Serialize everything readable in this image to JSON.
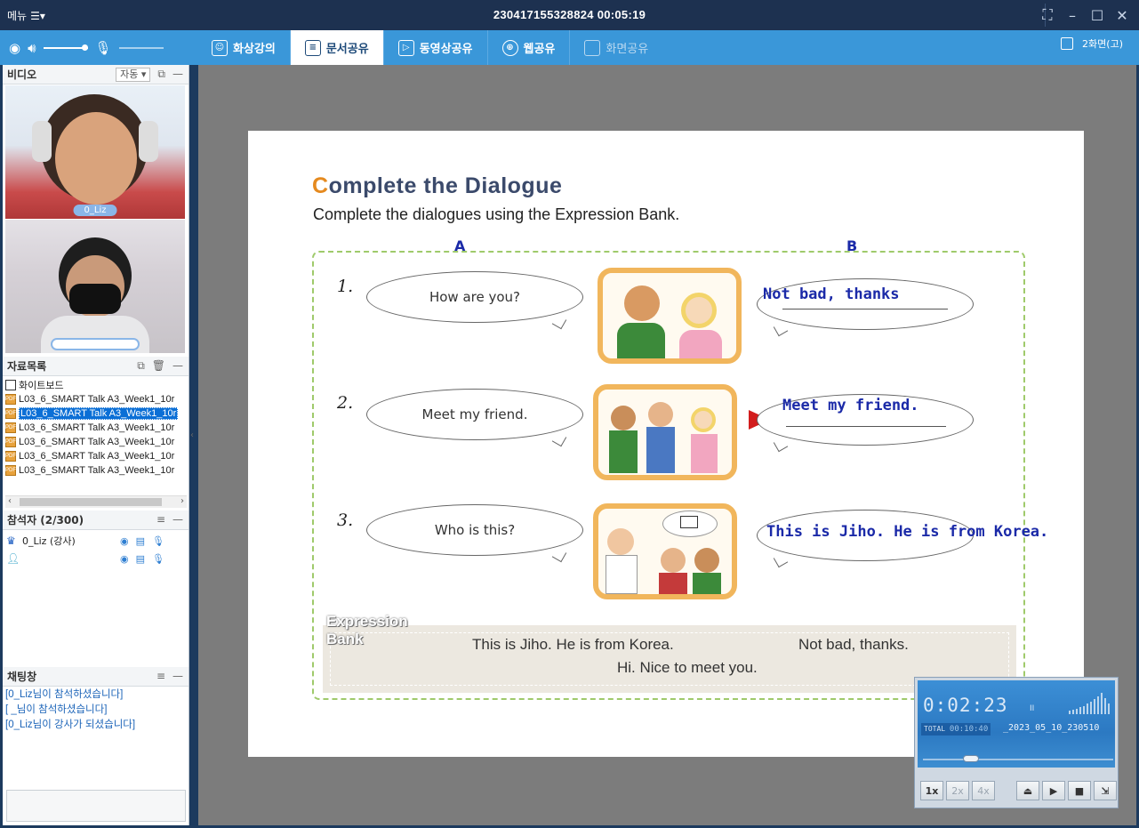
{
  "titlebar": {
    "menu_label": "메뉴",
    "session_title": "230417155328824 00:05:19"
  },
  "toolbar": {
    "tabs": [
      {
        "label": "화상강의",
        "icon": "person-frame-icon"
      },
      {
        "label": "문서공유",
        "icon": "document-icon"
      },
      {
        "label": "동영상공유",
        "icon": "play-icon"
      },
      {
        "label": "웹공유",
        "icon": "globe-icon"
      },
      {
        "label": "화면공유",
        "icon": "screen-icon"
      }
    ],
    "active_tab": "문서공유",
    "layout_label": "2화면(고)",
    "speaker_volume": 0.9,
    "mic_volume": 0.0
  },
  "video_panel": {
    "header": "비디오",
    "mode": "자동",
    "feeds": [
      {
        "name": "0_Liz"
      },
      {
        "name": ""
      }
    ]
  },
  "materials": {
    "header": "자료목록",
    "whiteboard": "화이트보드",
    "files": [
      "L03_6_SMART Talk A3_Week1_10r",
      "L03_6_SMART Talk A3_Week1_10r",
      "L03_6_SMART Talk A3_Week1_10r",
      "L03_6_SMART Talk A3_Week1_10r",
      "L03_6_SMART Talk A3_Week1_10r",
      "L03_6_SMART Talk A3_Week1_10r"
    ],
    "selected_index": 1
  },
  "participants": {
    "header": "참석자 (2/300)",
    "items": [
      {
        "name": "0_Liz (강사)",
        "role_icon": "crown-icon"
      },
      {
        "name": "",
        "role_icon": "user-icon"
      }
    ]
  },
  "chat": {
    "header": "채팅창",
    "messages": [
      "[0_Liz님이 참석하셨습니다]",
      "[                    _님이 참석하셨습니다]",
      "[0_Liz님이 강사가 되셨습니다]"
    ]
  },
  "document": {
    "title_first": "C",
    "title_rest": "omplete the Dialogue",
    "subtitle": "Complete the dialogues using the Expression Bank.",
    "col_a": "A",
    "col_b": "B",
    "rows": [
      {
        "num": "1.",
        "question": "How are you?",
        "answer": "Not bad, thanks"
      },
      {
        "num": "2.",
        "question": "Meet my friend.",
        "answer": "Meet my friend."
      },
      {
        "num": "3.",
        "question": "Who is this?",
        "answer": "This is Jiho. He is from Korea."
      }
    ],
    "expression_bank_label_1": "Expression",
    "expression_bank_label_2": "Bank",
    "expressions": [
      "This is Jiho. He is from Korea.",
      "Not bad, thanks.",
      "Hi. Nice to meet you."
    ]
  },
  "recorder": {
    "elapsed": "0:02:23",
    "total_label": "TOTAL",
    "total": "00:10:40",
    "filename": "_2023_05_10_230510",
    "progress": 0.23,
    "speeds": [
      "1x",
      "2x",
      "4x"
    ]
  }
}
